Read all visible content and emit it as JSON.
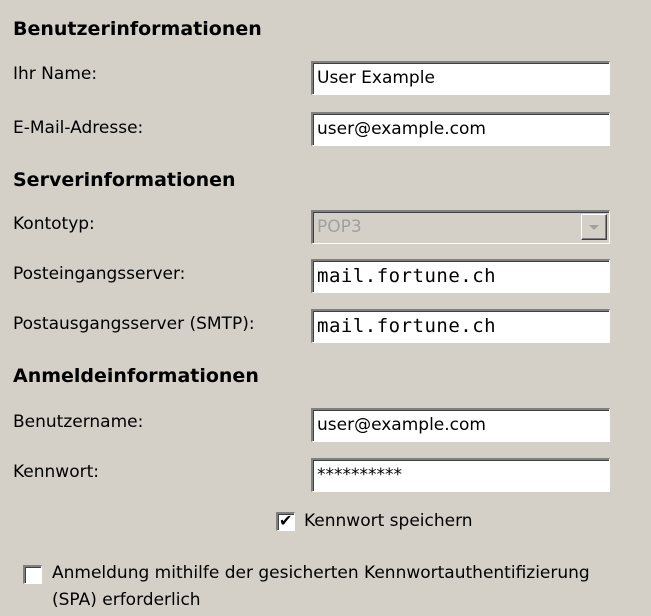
{
  "sections": {
    "user_info": "Benutzerinformationen",
    "server_info": "Serverinformationen",
    "login_info": "Anmeldeinformationen"
  },
  "fields": {
    "name": {
      "label": "Ihr Name:",
      "value": "User Example"
    },
    "email": {
      "label": "E-Mail-Adresse:",
      "value": "user@example.com"
    },
    "account_type": {
      "label": "Kontotyp:",
      "value": "POP3"
    },
    "incoming_server": {
      "label": "Posteingangsserver:",
      "value": "mail.fortune.ch"
    },
    "outgoing_server": {
      "label": "Postausgangsserver (SMTP):",
      "value": "mail.fortune.ch"
    },
    "username": {
      "label": "Benutzername:",
      "value": "user@example.com"
    },
    "password": {
      "label": "Kennwort:",
      "value": "**********"
    }
  },
  "checkboxes": {
    "save_password": {
      "label": "Kennwort speichern",
      "checked": true
    },
    "spa": {
      "label_line1": "Anmeldung mithilfe der gesicherten Kennwortauthentifizierung",
      "label_line2": "(SPA) erforderlich",
      "checked": false
    }
  },
  "icons": {
    "check": "✔"
  }
}
